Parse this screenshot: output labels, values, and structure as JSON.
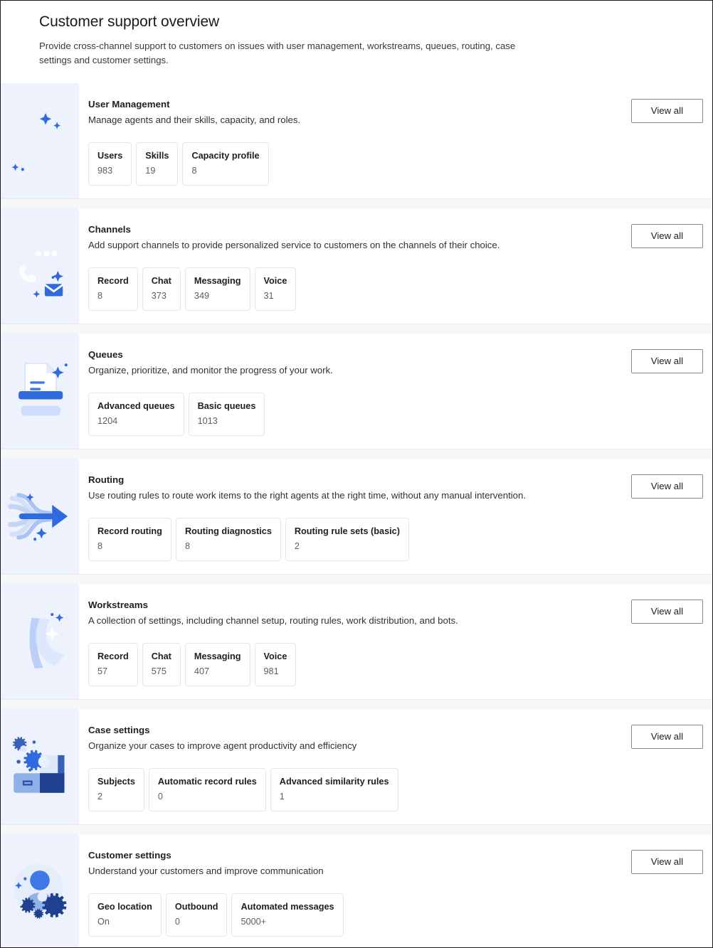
{
  "header": {
    "title": "Customer support overview",
    "subtitle": "Provide cross-channel support to customers on issues with user management, workstreams, queues, routing, case settings and customer settings."
  },
  "common": {
    "view_all_label": "View all"
  },
  "colors": {
    "icon_panel_bg": "#eef2fd",
    "accent_blue": "#2f6bde",
    "accent_blue_light": "#8fb0f2",
    "page_bg": "#f7f7f7",
    "card_bg": "#ffffff",
    "title_text": "#201f1e",
    "muted_text": "#605e5c",
    "tile_border": "#e6e6e6",
    "button_border": "#8a8886"
  },
  "cards": [
    {
      "id": "user-management",
      "icon": "people-icon",
      "title": "User Management",
      "description": "Manage agents and their skills, capacity, and roles.",
      "action_label": "View all",
      "stats": [
        {
          "label": "Users",
          "value": "983"
        },
        {
          "label": "Skills",
          "value": "19"
        },
        {
          "label": "Capacity profile",
          "value": "8"
        }
      ]
    },
    {
      "id": "channels",
      "icon": "chat-bubbles-phone-envelope-icon",
      "title": "Channels",
      "description": "Add support channels to provide personalized service to customers on the channels of their choice.",
      "action_label": "View all",
      "stats": [
        {
          "label": "Record",
          "value": "8"
        },
        {
          "label": "Chat",
          "value": "373"
        },
        {
          "label": "Messaging",
          "value": "349"
        },
        {
          "label": "Voice",
          "value": "31"
        }
      ]
    },
    {
      "id": "queues",
      "icon": "printer-document-icon",
      "title": "Queues",
      "description": "Organize, prioritize, and monitor the progress of your work.",
      "action_label": "View all",
      "stats": [
        {
          "label": "Advanced queues",
          "value": "1204"
        },
        {
          "label": "Basic queues",
          "value": "1013"
        }
      ]
    },
    {
      "id": "routing",
      "icon": "flow-arrow-icon",
      "title": "Routing",
      "description": "Use routing rules to route work items to the right agents at the right time, without any manual intervention.",
      "action_label": "View all",
      "stats": [
        {
          "label": "Record routing",
          "value": "8"
        },
        {
          "label": "Routing diagnostics",
          "value": "8"
        },
        {
          "label": "Routing rule sets (basic)",
          "value": "2"
        }
      ]
    },
    {
      "id": "workstreams",
      "icon": "sphere-swoosh-icon",
      "title": "Workstreams",
      "description": "A collection of settings, including channel setup, routing rules, work distribution, and bots.",
      "action_label": "View all",
      "stats": [
        {
          "label": "Record",
          "value": "57"
        },
        {
          "label": "Chat",
          "value": "575"
        },
        {
          "label": "Messaging",
          "value": "407"
        },
        {
          "label": "Voice",
          "value": "981"
        }
      ]
    },
    {
      "id": "case-settings",
      "icon": "briefcase-gears-icon",
      "title": "Case settings",
      "description": "Organize your cases to improve agent productivity and efficiency",
      "action_label": "View all",
      "stats": [
        {
          "label": "Subjects",
          "value": "2"
        },
        {
          "label": "Automatic record rules",
          "value": "0"
        },
        {
          "label": "Advanced similarity rules",
          "value": "1"
        }
      ]
    },
    {
      "id": "customer-settings",
      "icon": "person-gears-icon",
      "title": "Customer settings",
      "description": "Understand your customers and improve communication",
      "action_label": "View all",
      "stats": [
        {
          "label": "Geo location",
          "value": "On"
        },
        {
          "label": "Outbound",
          "value": "0"
        },
        {
          "label": "Automated messages",
          "value": "5000+"
        }
      ]
    }
  ]
}
